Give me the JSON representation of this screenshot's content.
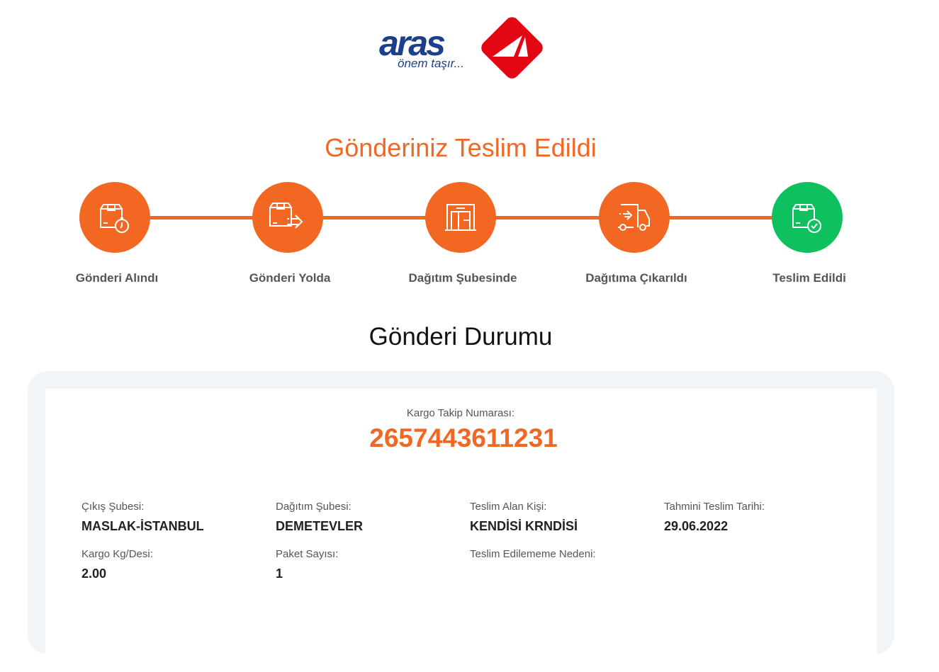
{
  "logo": {
    "brand": "aras",
    "tagline": "önem taşır...",
    "colors": {
      "blue": "#1c3f8c",
      "red": "#e30613"
    }
  },
  "status_title": "Gönderiniz Teslim Edildi",
  "steps": [
    {
      "label": "Gönderi Alındı",
      "icon": "package-clock-icon",
      "state": "done"
    },
    {
      "label": "Gönderi Yolda",
      "icon": "package-arrow-icon",
      "state": "done"
    },
    {
      "label": "Dağıtım Şubesinde",
      "icon": "warehouse-icon",
      "state": "done"
    },
    {
      "label": "Dağıtıma Çıkarıldı",
      "icon": "delivery-truck-icon",
      "state": "done"
    },
    {
      "label": "Teslim Edildi",
      "icon": "package-check-icon",
      "state": "current"
    }
  ],
  "colors": {
    "accent": "#f26722",
    "success": "#0fc15e"
  },
  "section_title": "Gönderi Durumu",
  "tracking": {
    "label": "Kargo Takip Numarası:",
    "number": "2657443611231"
  },
  "details": [
    {
      "label": "Çıkış Şubesi:",
      "value": "MASLAK-İSTANBUL"
    },
    {
      "label": "Dağıtım Şubesi:",
      "value": "DEMETEVLER"
    },
    {
      "label": "Teslim Alan Kişi:",
      "value": "KENDİSİ KRNDİSİ"
    },
    {
      "label": "Tahmini Teslim Tarihi:",
      "value": "29.06.2022"
    },
    {
      "label": "Kargo Kg/Desi:",
      "value": "2.00"
    },
    {
      "label": "Paket Sayısı:",
      "value": "1"
    },
    {
      "label": "Teslim Edilememe Nedeni:",
      "value": ""
    }
  ]
}
